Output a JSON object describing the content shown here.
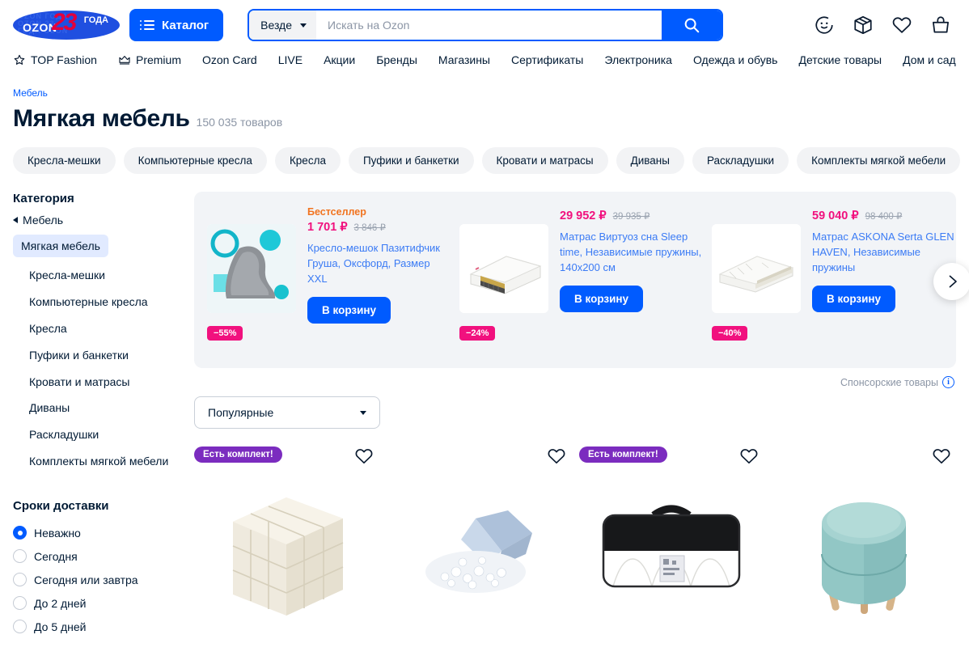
{
  "header": {
    "logo": {
      "brand": "OZON",
      "years": "23",
      "years_label": "ГОДА",
      "watermark": "OZON ГОДА\nOZON 23\nГОДА OZON"
    },
    "catalog_button": "Каталог",
    "search": {
      "scope": "Везде",
      "placeholder": "Искать на Ozon",
      "value": ""
    },
    "icons": [
      {
        "name": "profile-face-icon",
        "label": "Профиль"
      },
      {
        "name": "package-box-icon",
        "label": "Заказы"
      },
      {
        "name": "heart-icon",
        "label": "Избранное"
      },
      {
        "name": "basket-icon",
        "label": "Корзина"
      }
    ]
  },
  "nav": [
    {
      "label": "TOP Fashion",
      "icon": "star-icon"
    },
    {
      "label": "Premium",
      "icon": "crown-icon"
    },
    {
      "label": "Ozon Card",
      "icon": ""
    },
    {
      "label": "LIVE",
      "icon": ""
    },
    {
      "label": "Акции",
      "icon": ""
    },
    {
      "label": "Бренды",
      "icon": ""
    },
    {
      "label": "Магазины",
      "icon": ""
    },
    {
      "label": "Сертификаты",
      "icon": ""
    },
    {
      "label": "Электроника",
      "icon": ""
    },
    {
      "label": "Одежда и обувь",
      "icon": ""
    },
    {
      "label": "Детские товары",
      "icon": ""
    },
    {
      "label": "Дом и сад",
      "icon": ""
    }
  ],
  "breadcrumb": "Мебель",
  "page": {
    "title": "Мягкая мебель",
    "count": "150 035 товаров"
  },
  "chips": [
    "Кресла-мешки",
    "Компьютерные кресла",
    "Кресла",
    "Пуфики и банкетки",
    "Кровати и матрасы",
    "Диваны",
    "Раскладушки",
    "Комплекты мягкой мебели"
  ],
  "sidebar": {
    "category_title": "Категория",
    "back_label": "Мебель",
    "current": "Мягкая мебель",
    "items": [
      "Кресла-мешки",
      "Компьютерные кресла",
      "Кресла",
      "Пуфики и банкетки",
      "Кровати и матрасы",
      "Диваны",
      "Раскладушки",
      "Комплекты мягкой мебели"
    ],
    "delivery_title": "Сроки доставки",
    "delivery_options": [
      {
        "label": "Неважно",
        "selected": true
      },
      {
        "label": "Сегодня",
        "selected": false
      },
      {
        "label": "Сегодня или завтра",
        "selected": false
      },
      {
        "label": "До 2 дней",
        "selected": false
      },
      {
        "label": "До 5 дней",
        "selected": false
      }
    ]
  },
  "promo": {
    "sponsor_label": "Спонсорские товары",
    "next_icon": "chevron-right-icon",
    "cards": [
      {
        "tag": "Бестселлер",
        "price": "1 701 ₽",
        "old_price": "3 846 ₽",
        "discount": "−55%",
        "name": "Кресло-мешок Пазитифчик Груша, Оксфорд, Размер XXL",
        "button": "В корзину",
        "image": "grey-beanbag"
      },
      {
        "tag": "",
        "price": "29 952 ₽",
        "old_price": "39 935 ₽",
        "discount": "−24%",
        "name": "Матрас Виртуоз сна Sleep time, Независимые пружины, 140x200 см",
        "button": "В корзину",
        "image": "white-mattress"
      },
      {
        "tag": "",
        "price": "59 040 ₽",
        "old_price": "98 400 ₽",
        "discount": "−40%",
        "name": "Матрас ASKONA Serta GLEN HAVEN, Независимые пружины",
        "button": "В корзину",
        "image": "askona-mattress"
      }
    ]
  },
  "sort": {
    "value": "Популярные"
  },
  "products": [
    {
      "badge": "Есть комплект!",
      "favorite_icon": "heart-icon",
      "image": "beige-cube-pouf"
    },
    {
      "badge": "",
      "favorite_icon": "heart-icon",
      "image": "filler-beads-bag"
    },
    {
      "badge": "Есть комплект!",
      "favorite_icon": "heart-icon",
      "image": "rolled-mattress-bag"
    },
    {
      "badge": "",
      "favorite_icon": "heart-icon",
      "image": "teal-round-pouf"
    }
  ],
  "colors": {
    "brand_blue": "#005bff",
    "accent_pink": "#f1117e",
    "bestseller_orange": "#f1731f",
    "link_blue": "#3b7bf5",
    "kit_purple": "#7b2cbf",
    "muted": "#8b95a5"
  }
}
